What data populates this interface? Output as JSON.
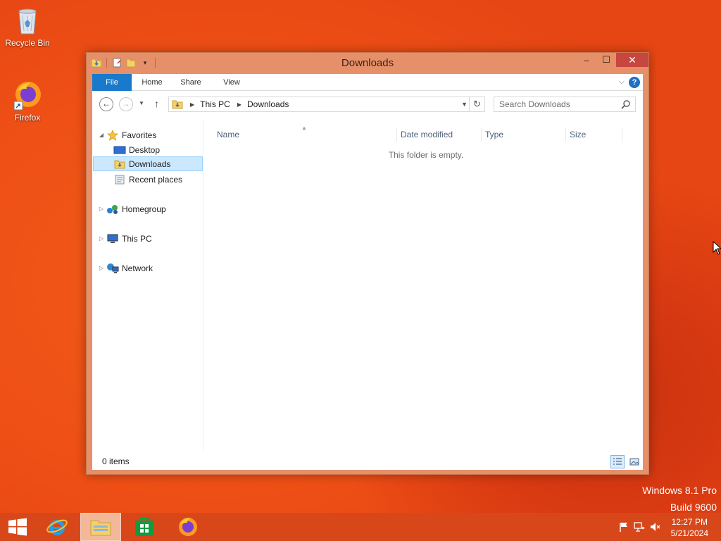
{
  "desktop": {
    "icons": [
      {
        "label": "Recycle Bin",
        "icon": "recycle-bin-icon"
      },
      {
        "label": "Firefox",
        "icon": "firefox-icon"
      }
    ],
    "watermark": {
      "line1": "Windows 8.1 Pro",
      "line2": "Build 9600"
    }
  },
  "window": {
    "title": "Downloads",
    "controls": {
      "minimize": "–",
      "maximize": "☐",
      "close": "✕"
    },
    "ribbon": {
      "tabs": [
        {
          "label": "File"
        },
        {
          "label": "Home"
        },
        {
          "label": "Share"
        },
        {
          "label": "View"
        }
      ],
      "help": "?"
    },
    "address": {
      "segments": [
        "This PC",
        "Downloads"
      ]
    },
    "search": {
      "placeholder": "Search Downloads"
    },
    "navpane": {
      "favorites": "Favorites",
      "desktop": "Desktop",
      "downloads": "Downloads",
      "recent": "Recent places",
      "homegroup": "Homegroup",
      "thispc": "This PC",
      "network": "Network"
    },
    "columns": [
      "Name",
      "Date modified",
      "Type",
      "Size"
    ],
    "empty_message": "This folder is empty.",
    "status": {
      "item_count": "0 items"
    }
  },
  "taskbar": {
    "items": [
      "start-button",
      "internet-explorer",
      "file-explorer",
      "windows-store",
      "firefox"
    ],
    "clock": {
      "time": "12:27 PM",
      "date": "5/21/2024"
    }
  },
  "colors": {
    "accent": "#1979ca",
    "window_frame": "#e6906a",
    "taskbar": "#d8471a",
    "close_button": "#c7463f",
    "selection": "#cce8ff"
  }
}
